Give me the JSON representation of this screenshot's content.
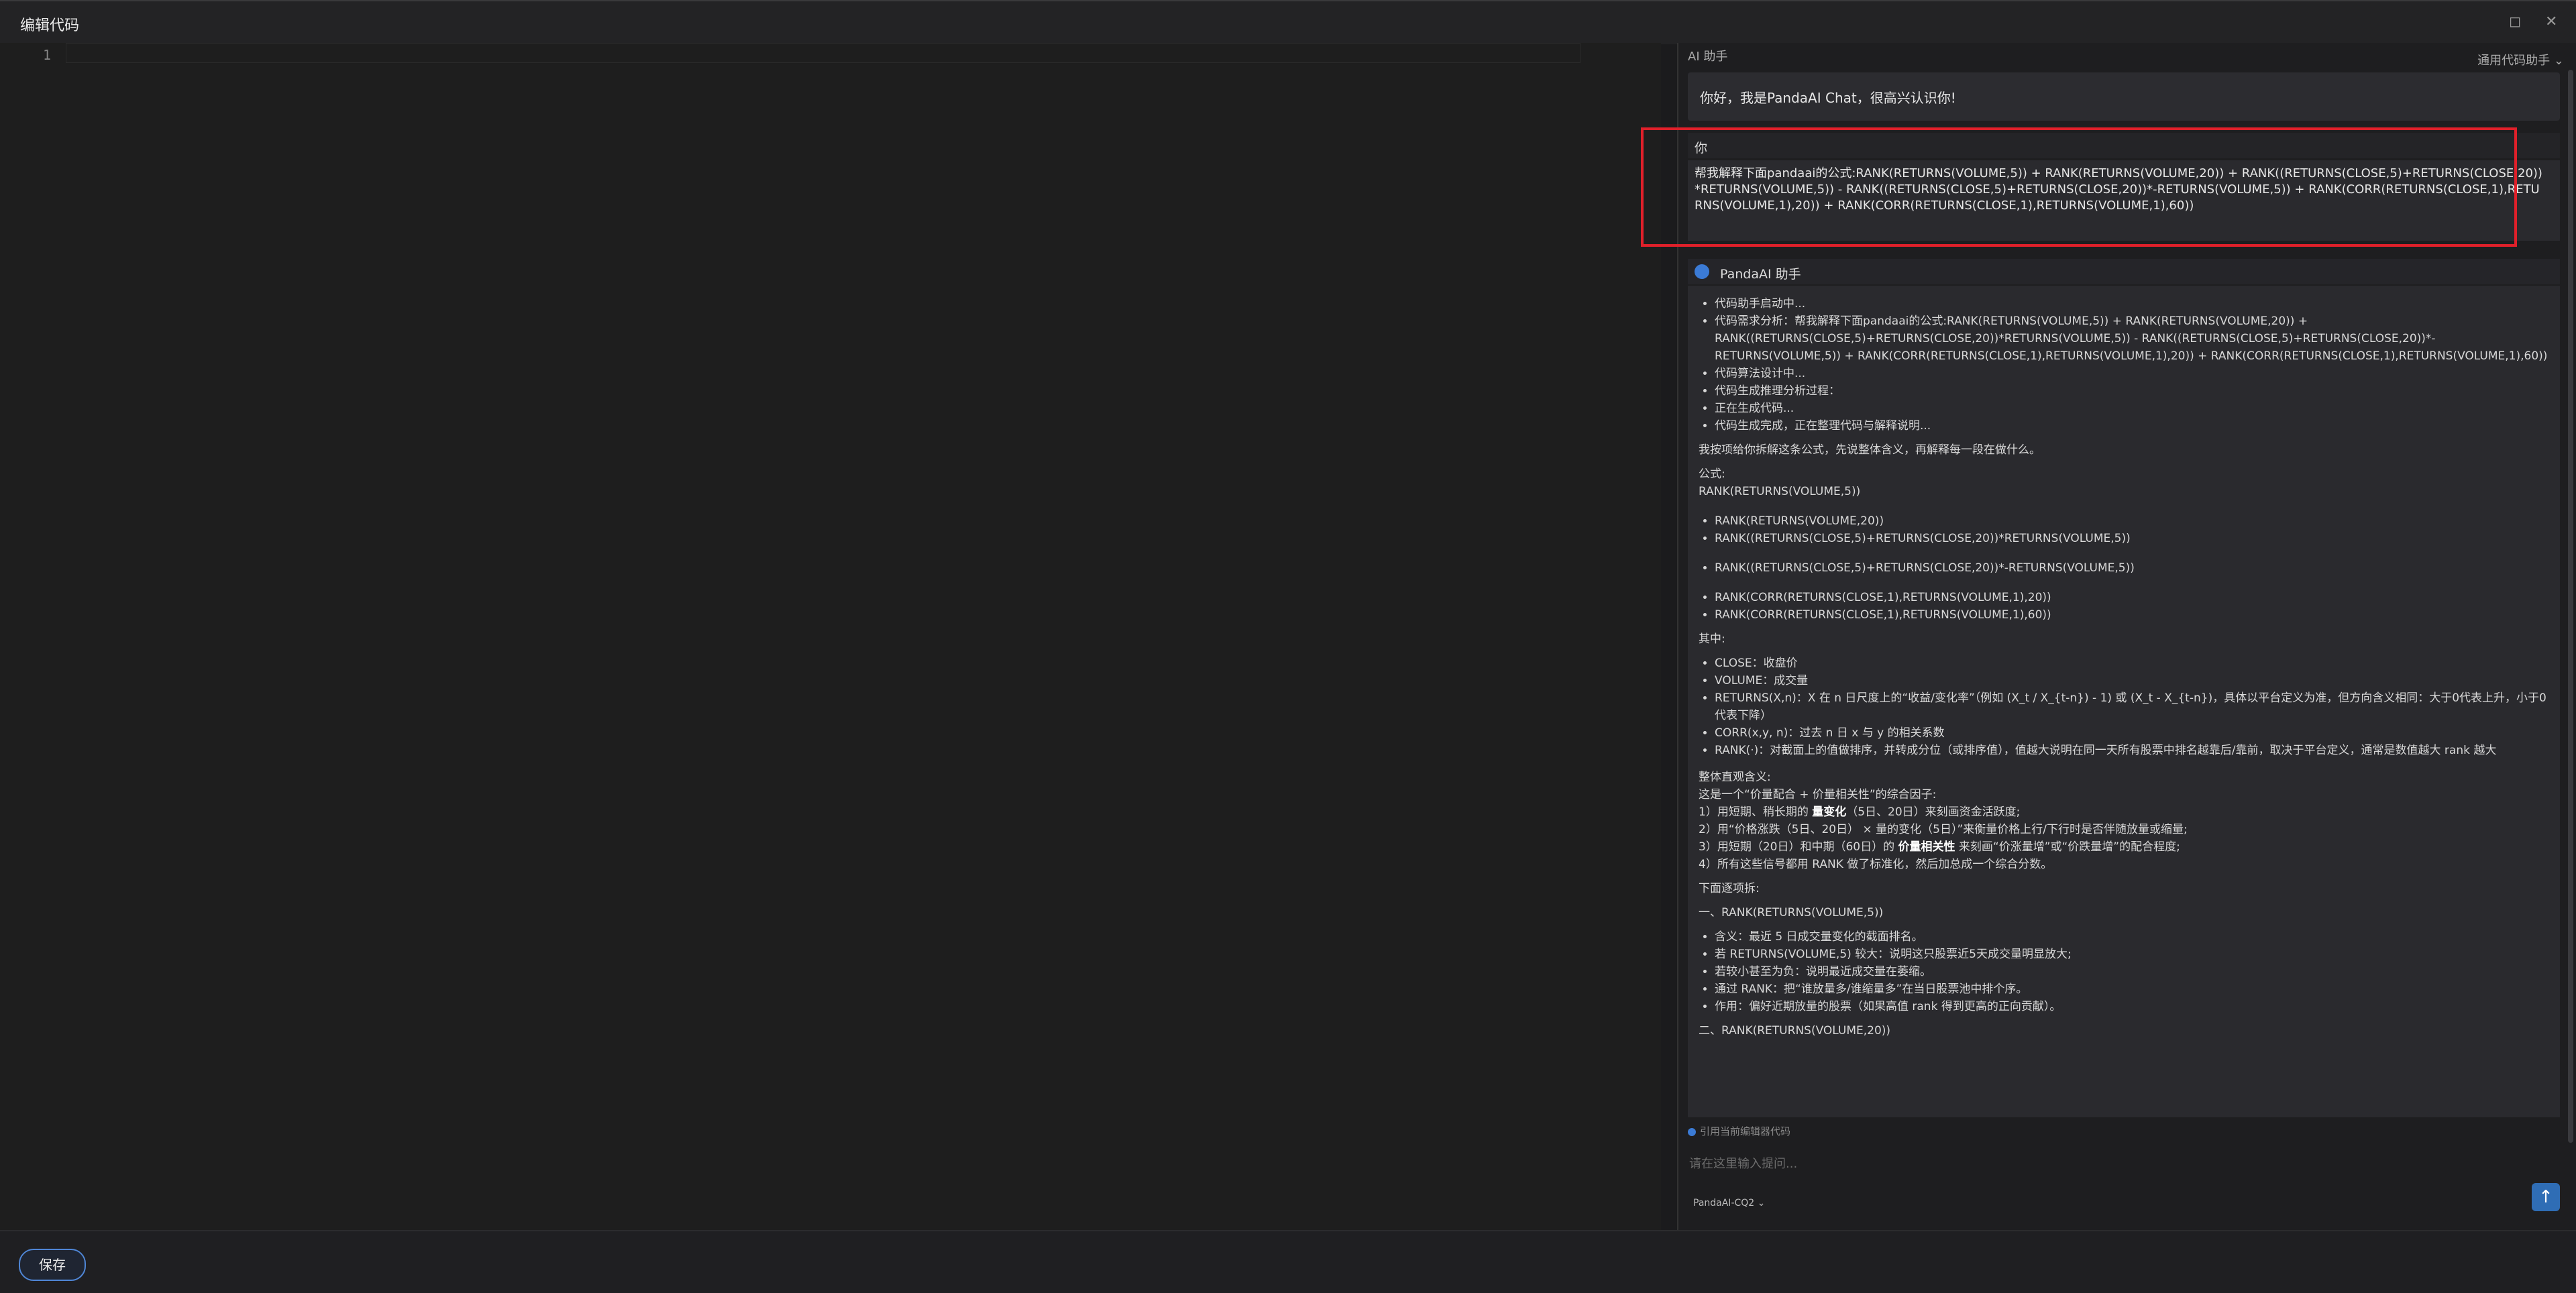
{
  "window": {
    "title": "编辑代码",
    "maximize_icon": "maximize-icon",
    "close_icon": "close-icon"
  },
  "editor": {
    "line_numbers": [
      "1"
    ]
  },
  "assistant_panel": {
    "title": "AI 助手",
    "mode_select": "通用代码助手",
    "greeting": "你好，我是PandaAI Chat，很高兴认识你!",
    "user_label": "你",
    "user_message": "帮我解释下面pandaai的公式:RANK(RETURNS(VOLUME,5)) + RANK(RETURNS(VOLUME,20)) + RANK((RETURNS(CLOSE,5)+RETURNS(CLOSE,20))*RETURNS(VOLUME,5)) - RANK((RETURNS(CLOSE,5)+RETURNS(CLOSE,20))*-RETURNS(VOLUME,5)) + RANK(CORR(RETURNS(CLOSE,1),RETURNS(VOLUME,1),20)) + RANK(CORR(RETURNS(CLOSE,1),RETURNS(VOLUME,1),60))",
    "assistant_name": "PandaAI 助手",
    "progress": [
      "代码助手启动中...",
      "代码需求分析：帮我解释下面pandaai的公式:RANK(RETURNS(VOLUME,5)) + RANK(RETURNS(VOLUME,20)) + RANK((RETURNS(CLOSE,5)+RETURNS(CLOSE,20))*RETURNS(VOLUME,5)) - RANK((RETURNS(CLOSE,5)+RETURNS(CLOSE,20))*-RETURNS(VOLUME,5)) + RANK(CORR(RETURNS(CLOSE,1),RETURNS(VOLUME,1),20)) + RANK(CORR(RETURNS(CLOSE,1),RETURNS(VOLUME,1),60))",
      "代码算法设计中...",
      "代码生成推理分析过程：",
      "正在生成代码...",
      "代码生成完成，正在整理代码与解释说明..."
    ],
    "intro": "我按项给你拆解这条公式，先说整体含义，再解释每一段在做什么。",
    "formula_label": "公式:",
    "formula_first": "RANK(RETURNS(VOLUME,5))",
    "formula_terms": [
      "RANK(RETURNS(VOLUME,20))",
      "RANK((RETURNS(CLOSE,5)+RETURNS(CLOSE,20))*RETURNS(VOLUME,5))",
      "RANK((RETURNS(CLOSE,5)+RETURNS(CLOSE,20))*-RETURNS(VOLUME,5))",
      "RANK(CORR(RETURNS(CLOSE,1),RETURNS(VOLUME,1),20))",
      "RANK(CORR(RETURNS(CLOSE,1),RETURNS(VOLUME,1),60))"
    ],
    "where_label": "其中:",
    "definitions": [
      "CLOSE：收盘价",
      "VOLUME：成交量",
      "RETURNS(X,n)：X 在 n 日尺度上的“收益/变化率”（例如 (X_t / X_{t-n}) - 1) 或 (X_t - X_{t-n})，具体以平台定义为准，但方向含义相同：大于0代表上升，小于0代表下降）",
      "CORR(x,y, n)：过去 n 日 x 与 y 的相关系数",
      "RANK(·)：对截面上的值做排序，并转成分位（或排序值），值越大说明在同一天所有股票中排名越靠后/靠前，取决于平台定义，通常是数值越大 rank 越大"
    ],
    "overall_label": "整体直观含义:",
    "overall_intro": "这是一个“价量配合 + 价量相关性”的综合因子:",
    "overall_points": [
      {
        "pre": "1）用短期、稍长期的 ",
        "bold": "量变化",
        "post": "（5日、20日）来刻画资金活跃度;"
      },
      {
        "pre": "2）用“价格涨跌（5日、20日） × 量的变化（5日）”来衡量价格上行/下行时是否伴随放量或缩量;",
        "bold": "",
        "post": ""
      },
      {
        "pre": "3）用短期（20日）和中期（60日）的 ",
        "bold": "价量相关性",
        "post": " 来刻画“价涨量增”或“价跌量增”的配合程度;"
      },
      {
        "pre": "4）所有这些信号都用 RANK 做了标准化，然后加总成一个综合分数。",
        "bold": "",
        "post": ""
      }
    ],
    "breakdown_label": "下面逐项拆:",
    "section1_title": "一、RANK(RETURNS(VOLUME,5))",
    "section1_points": [
      "含义：最近 5 日成交量变化的截面排名。",
      "若 RETURNS(VOLUME,5) 较大：说明这只股票近5天成交量明显放大;",
      "若较小甚至为负：说明最近成交量在萎缩。",
      "通过 RANK：把“谁放量多/谁缩量多”在当日股票池中排个序。",
      "作用：偏好近期放量的股票（如果高值 rank 得到更高的正向贡献）。"
    ],
    "section2_title": "二、RANK(RETURNS(VOLUME,20))",
    "cite_label": "引用当前编辑器代码",
    "input_placeholder": "请在这里输入提问...",
    "model": "PandaAI-CQ2",
    "send_icon": "send-arrow-icon"
  },
  "footer": {
    "save_label": "保存"
  }
}
